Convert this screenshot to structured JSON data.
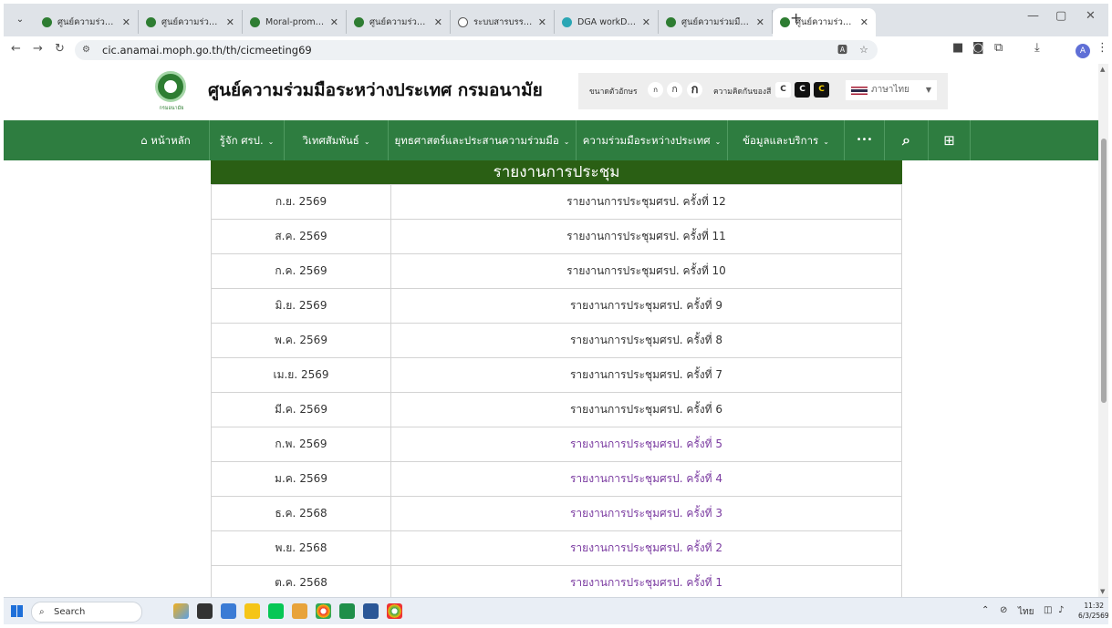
{
  "browser": {
    "tabs": [
      {
        "title": "ศูนย์ความร่วมมือระห",
        "icon": "anamai-favicon",
        "active": false
      },
      {
        "title": "ศูนย์ความร่วมมือระห",
        "icon": "anamai-favicon",
        "active": false
      },
      {
        "title": "Moral-promotion",
        "icon": "anamai-favicon",
        "active": false
      },
      {
        "title": "ศูนย์ความร่วมมือระห",
        "icon": "anamai-favicon",
        "active": false
      },
      {
        "title": "ระบบสารบรรณอิเล็กท",
        "icon": "globe-icon",
        "active": false
      },
      {
        "title": "DGA workD Platfo",
        "icon": "dga-favicon",
        "active": false
      },
      {
        "title": "ศูนย์ความร่วมมือระห",
        "icon": "anamai-favicon",
        "active": false
      },
      {
        "title": "ศูนย์ความร่วมมือระห",
        "icon": "anamai-favicon",
        "active": true
      }
    ],
    "url": "cic.anamai.moph.go.th/th/cicmeeting69",
    "profile_initial": "A"
  },
  "site": {
    "logo_caption": "กรมอนามัย",
    "title": "ศูนย์ความร่วมมือระหว่างประเทศ กรมอนามัย",
    "font_size_label": "ขนาดตัวอักษร",
    "font_size_buttons": [
      "ก",
      "ก",
      "ก"
    ],
    "contrast_label": "ความคิดกันของสี",
    "contrast_buttons": [
      "C",
      "C",
      "C"
    ],
    "language": "ภาษาไทย"
  },
  "nav": {
    "home": "หน้าหลัก",
    "items": [
      "รู้จัก ศรป.",
      "วิเทศสัมพันธ์",
      "ยุทธศาสตร์และประสานความร่วมมือ",
      "ความร่วมมือระหว่างประเทศ",
      "ข้อมูลและบริการ"
    ],
    "more": "•••"
  },
  "report": {
    "heading": "รายงานการประชุม",
    "rows": [
      {
        "date": "ก.ย. 2569",
        "title": "รายงานการประชุมศรป. ครั้งที่ 12",
        "visited": false
      },
      {
        "date": "ส.ค. 2569",
        "title": "รายงานการประชุมศรป. ครั้งที่ 11",
        "visited": false
      },
      {
        "date": "ก.ค. 2569",
        "title": "รายงานการประชุมศรป. ครั้งที่ 10",
        "visited": false
      },
      {
        "date": "มิ.ย. 2569",
        "title": "รายงานการประชุมศรป. ครั้งที่ 9",
        "visited": false
      },
      {
        "date": "พ.ค. 2569",
        "title": "รายงานการประชุมศรป. ครั้งที่ 8",
        "visited": false
      },
      {
        "date": "เม.ย. 2569",
        "title": "รายงานการประชุมศรป. ครั้งที่ 7",
        "visited": false
      },
      {
        "date": "มี.ค. 2569",
        "title": "รายงานการประชุมศรป. ครั้งที่ 6",
        "visited": false
      },
      {
        "date": "ก.พ. 2569",
        "title": "รายงานการประชุมศรป. ครั้งที่ 5",
        "visited": true
      },
      {
        "date": "ม.ค. 2569",
        "title": "รายงานการประชุมศรป. ครั้งที่ 4",
        "visited": true
      },
      {
        "date": "ธ.ค. 2568",
        "title": "รายงานการประชุมศรป. ครั้งที่ 3",
        "visited": true
      },
      {
        "date": "พ.ย. 2568",
        "title": "รายงานการประชุมศรป. ครั้งที่ 2",
        "visited": true
      },
      {
        "date": "ต.ค. 2568",
        "title": "รายงานการประชุมศรป. ครั้งที่ 1",
        "visited": true
      }
    ]
  },
  "taskbar": {
    "search_label": "Search",
    "time": "11:32",
    "date": "6/3/2569"
  },
  "colors": {
    "nav_green": "#2e7d40",
    "report_header_green": "#2a5f14",
    "visited_link": "#7a3aa0"
  }
}
